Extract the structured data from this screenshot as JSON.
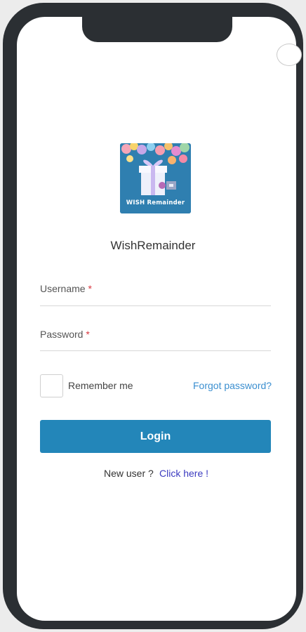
{
  "app": {
    "name": "WishRemainder",
    "logo_caption": "WISH Remainder"
  },
  "form": {
    "username_label": "Username",
    "password_label": "Password",
    "required_mark": "*",
    "username_value": "",
    "password_value": "",
    "remember_label": "Remember me",
    "remember_checked": false,
    "forgot_link": "Forgot password?",
    "login_button": "Login"
  },
  "signup": {
    "prompt": "New user ?",
    "link": "Click here !"
  },
  "colors": {
    "primary": "#2386b9",
    "link": "#3b8fd0",
    "required": "#d9363e",
    "phone_frame": "#2b2f33"
  },
  "icons": [
    "gift-box-icon",
    "balloons-icon"
  ]
}
